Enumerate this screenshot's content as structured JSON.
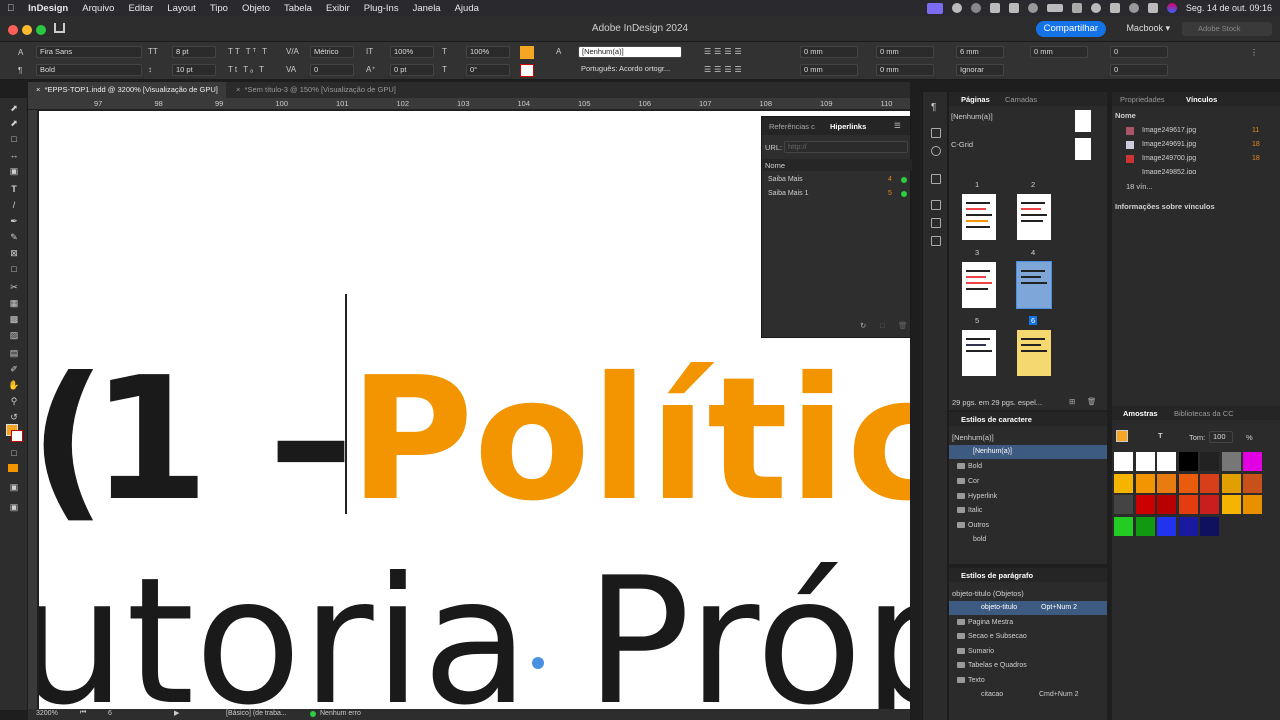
{
  "menubar": {
    "app": "InDesign",
    "items": [
      "Arquivo",
      "Editar",
      "Layout",
      "Tipo",
      "Objeto",
      "Tabela",
      "Exibir",
      "Plug-Ins",
      "Janela",
      "Ajuda"
    ],
    "datetime": "Seg. 14 de out.  09:16"
  },
  "titlebar": {
    "title": "Adobe InDesign 2024",
    "share_label": "Compartilhar",
    "workspace": "Macbook",
    "search_placeholder": "Adobe Stock"
  },
  "control": {
    "font": "Fira Sans",
    "style": "Bold",
    "size": "8 pt",
    "leading": "10 pt",
    "kerning": "Métrico",
    "tracking": "0",
    "vscale": "100%",
    "hscale": "100%",
    "baseline": "0 pt",
    "skew": "0°",
    "char_style": "[Nenhum(a)]",
    "language": "Português: Acordo ortogr...",
    "indent1": "0 mm",
    "indent2": "0 mm",
    "indent3": "0 mm",
    "indent4": "0 mm",
    "space1": "6 mm",
    "space2": "0 mm",
    "space3": "0",
    "space4": "0",
    "hyph": "Ignorar"
  },
  "tabs": [
    {
      "label": "*EPPS-TOP1.indd @ 3200% [Visualização de GPU]"
    },
    {
      "label": "*Sem título-3 @ 150% [Visualização de GPU]"
    }
  ],
  "ruler_ticks": [
    "97",
    "98",
    "99",
    "100",
    "101",
    "102",
    "103",
    "104",
    "105",
    "106",
    "107",
    "108",
    "109",
    "110"
  ],
  "canvas": {
    "number": "1 –",
    "word": "Política",
    "line2": "utoria Próp",
    "colors": {
      "orange": "#f29500",
      "dark": "#1a1a1a"
    }
  },
  "status": {
    "zoom": "3200%",
    "page": "6",
    "profile": "[Básico] (de traba...",
    "preflight": "Nenhum erro"
  },
  "hyperlinks": {
    "tab1": "Referências c",
    "tab2": "Hiperlinks",
    "url_label": "URL:",
    "url_placeholder": "http://",
    "col_name": "Nome",
    "items": [
      {
        "name": "Saiba Mais",
        "page": "4"
      },
      {
        "name": "Saiba Mais 1",
        "page": "5"
      }
    ]
  },
  "pages": {
    "tab1": "Páginas",
    "tab2": "Camadas",
    "masters": [
      "[Nenhum(a)]",
      "C-Grid"
    ],
    "numbers": [
      "1",
      "2",
      "3",
      "4",
      "5",
      "6"
    ],
    "footer": "29 pgs. em 29 pgs. espel..."
  },
  "links": {
    "tab1": "Propriedades",
    "tab2": "Vínculos",
    "col_name": "Nome",
    "items": [
      {
        "name": "Image249617.jpg",
        "page": "11"
      },
      {
        "name": "Image249691.jpg",
        "page": "18"
      },
      {
        "name": "Image249700.jpg",
        "page": "18"
      },
      {
        "name": "Image249852.jpg",
        "page": "18"
      }
    ],
    "count": "18 vín...",
    "info": "Informações sobre vínculos"
  },
  "char_styles": {
    "title": "Estilos de caractere",
    "current": "[Nenhum(a)]",
    "items": [
      "[Nenhum(a)]",
      "Bold",
      "Cor",
      "Hyperlink",
      "Italic",
      "Outros",
      "bold"
    ]
  },
  "para_styles": {
    "title": "Estilos de parágrafo",
    "current": "objeto-titulo (Objetos)",
    "selected": "objeto-titulo",
    "selected_shortcut": "Opt+Num 2",
    "items": [
      "Pagina Mestra",
      "Secao e Subsecao",
      "Sumario",
      "Tabelas e Quadros",
      "Texto"
    ],
    "sub": "citacao",
    "sub_shortcut": "Cmd+Num 2"
  },
  "swatches": {
    "tab1": "Amostras",
    "tab2": "Bibliotecas da CC",
    "tint_label": "Tom:",
    "tint": "100",
    "pct": "%",
    "colors": [
      "#ffffff",
      "#ffffff",
      "#ffffff",
      "#000000",
      "#222222",
      "#777777",
      "#e200e2",
      "#f5b400",
      "#f29500",
      "#e97c10",
      "#e85c0c",
      "#d63f1a",
      "#e2a000",
      "#c8501a",
      "#444444",
      "#cc0000",
      "#b80000",
      "#e23c10",
      "#c81e1e",
      "#f5b400",
      "#e89000",
      "#22cc22",
      "#119911",
      "#2233ee",
      "#1a1aa0",
      "#101060"
    ]
  }
}
